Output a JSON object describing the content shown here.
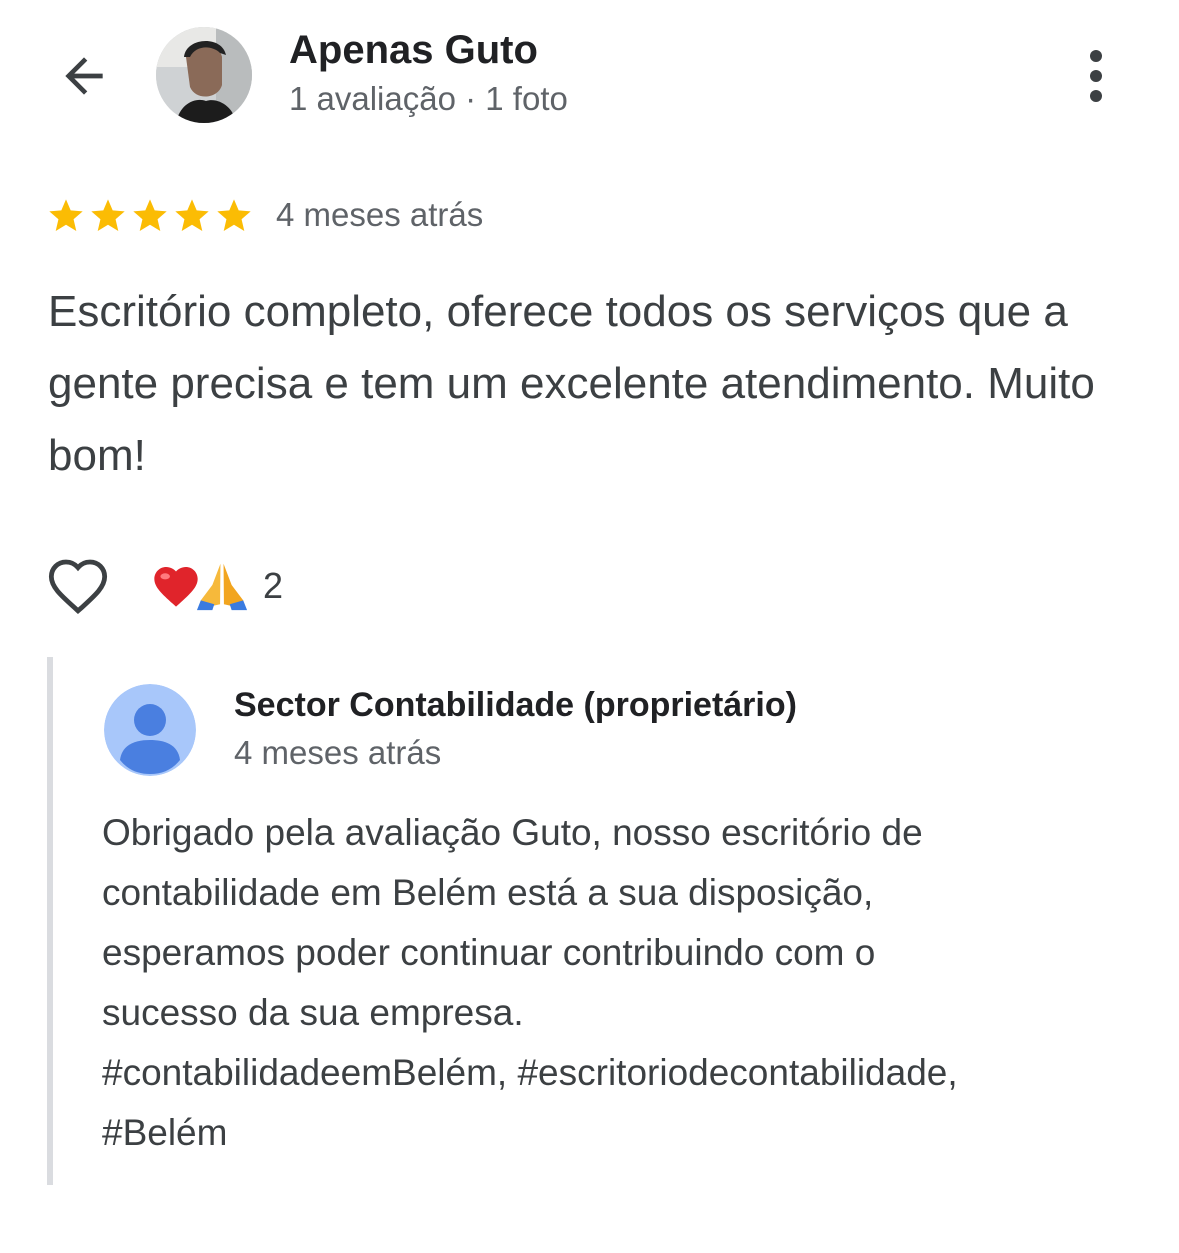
{
  "header": {
    "reviewer_name": "Apenas Guto",
    "reviewer_meta": "1 avaliação · 1 foto"
  },
  "review": {
    "rating": 5,
    "rating_max": 5,
    "star_color": "#fbbc04",
    "date": "4 meses atrás",
    "text": "Escritório completo, oferece todos os serviços que a gente precisa e tem um excelente atendimento. Muito bom!",
    "reactions": "❤️🙏",
    "reaction_count": "2"
  },
  "owner_reply": {
    "name": "Sector Contabilidade (proprietário)",
    "date": "4 meses atrás",
    "lines": [
      "Obrigado pela avaliação Guto, nosso escritório de",
      "contabilidade em Belém está a sua disposição,",
      "esperamos poder continuar contribuindo com o",
      "sucesso da sua empresa.",
      "#contabilidadeemBelém, #escritoriodecontabilidade,",
      "#Belém"
    ]
  },
  "icons": {
    "back": "arrow-back-icon",
    "menu": "more-vert-icon",
    "like": "heart-outline-icon",
    "owner_avatar": "default-person-avatar-icon"
  }
}
